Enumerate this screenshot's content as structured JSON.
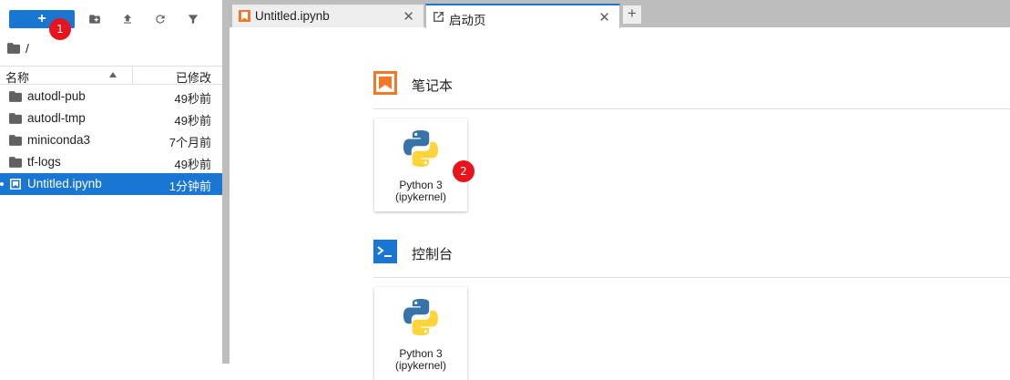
{
  "toolbar": {
    "new_label": "+",
    "marker_1": "1",
    "buttons": [
      "new-folder-icon",
      "upload-icon",
      "refresh-icon",
      "filter-icon"
    ]
  },
  "breadcrumb": {
    "path": "/"
  },
  "file_list": {
    "col_name": "名称",
    "col_modified": "已修改",
    "items": [
      {
        "name": "autodl-pub",
        "modified": "49秒前",
        "icon": "folder-icon"
      },
      {
        "name": "autodl-tmp",
        "modified": "49秒前",
        "icon": "folder-icon"
      },
      {
        "name": "miniconda3",
        "modified": "7个月前",
        "icon": "folder-icon"
      },
      {
        "name": "tf-logs",
        "modified": "49秒前",
        "icon": "folder-icon"
      },
      {
        "name": "Untitled.ipynb",
        "modified": "1分钟前",
        "icon": "notebook-icon",
        "selected": true
      }
    ]
  },
  "tabs": [
    {
      "label": "Untitled.ipynb",
      "close": "✕",
      "icon": "notebook-icon"
    },
    {
      "label": "启动页",
      "close": "✕",
      "icon": "launcher-icon",
      "active": true
    }
  ],
  "add_tab": "+",
  "launcher": {
    "notebook": {
      "title": "笔记本",
      "card_line1": "Python 3",
      "card_line2": "(ipykernel)"
    },
    "console": {
      "title": "控制台",
      "card_line1": "Python 3",
      "card_line2": "(ipykernel)"
    },
    "marker_2": "2"
  },
  "colors": {
    "accent": "#1976d2",
    "marker": "#e8141b",
    "notebook_orange": "#f37726"
  }
}
